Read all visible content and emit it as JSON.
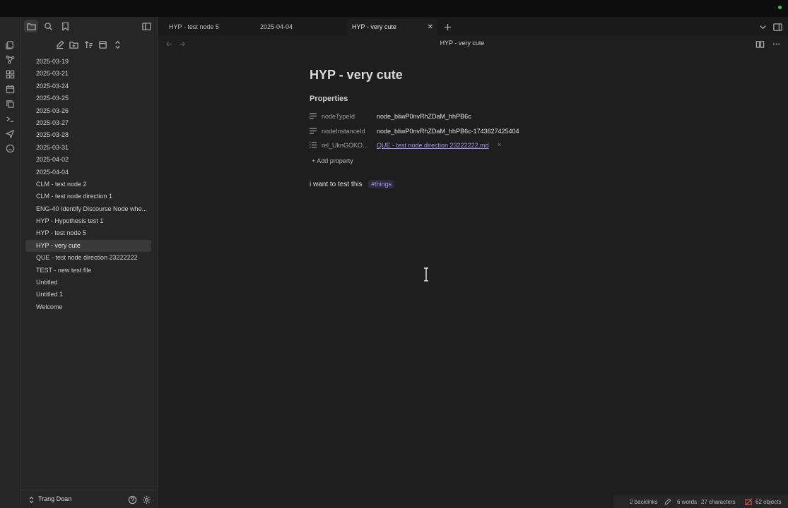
{
  "window": {
    "status_dot_color": "#2ecc40"
  },
  "ribbon": {
    "icons": [
      "files-icon",
      "graph-icon",
      "blocks-icon",
      "calendar-icon",
      "copy-icon",
      "terminal-icon",
      "send-icon",
      "face-icon"
    ]
  },
  "sidebar": {
    "files": [
      "2025-03-19",
      "2025-03-21",
      "2025-03-24",
      "2025-03-25",
      "2025-03-26",
      "2025-03-27",
      "2025-03-28",
      "2025-03-31",
      "2025-04-02",
      "2025-04-04",
      "CLM - test node 2",
      "CLM - test node direction 1",
      "ENG-40 Identify Discourse Node whe...",
      "HYP - Hypothesis test 1",
      "HYP - test node 5",
      "HYP - very cute",
      "QUE - test node direction 23222222",
      "TEST - new test file",
      "Untitled",
      "Untitled 1",
      "Welcome"
    ],
    "active_file": "HYP - very cute",
    "vault_user": "Trang Doan"
  },
  "tabs": [
    {
      "label": "HYP - test node 5",
      "active": false
    },
    {
      "label": "2025-04-04",
      "active": false
    },
    {
      "label": "HYP - very cute",
      "active": true
    }
  ],
  "view": {
    "header_title": "HYP - very cute"
  },
  "note": {
    "title": "HYP - very cute",
    "properties_heading": "Properties",
    "properties": [
      {
        "key": "nodeTypeId",
        "value": "node_bliwP0nvRhZDaM_hhPB6c",
        "kind": "text"
      },
      {
        "key": "nodeInstanceId",
        "value": "node_bliwP0nvRhZDaM_hhPB6c-1743627425404",
        "kind": "text"
      },
      {
        "key": "rel_UknGOKO...",
        "value": "QUE - test node direction 23222222.md",
        "kind": "link"
      }
    ],
    "add_property": "Add property",
    "body": "i want to test this",
    "tag": "#things"
  },
  "statusbar": {
    "backlinks": "2 backlinks",
    "words": "6 words",
    "characters": "27 characters",
    "objects": "62 objects"
  },
  "colors": {
    "accent": "#a98ff2",
    "tag_bg": "#2d2a3c"
  }
}
